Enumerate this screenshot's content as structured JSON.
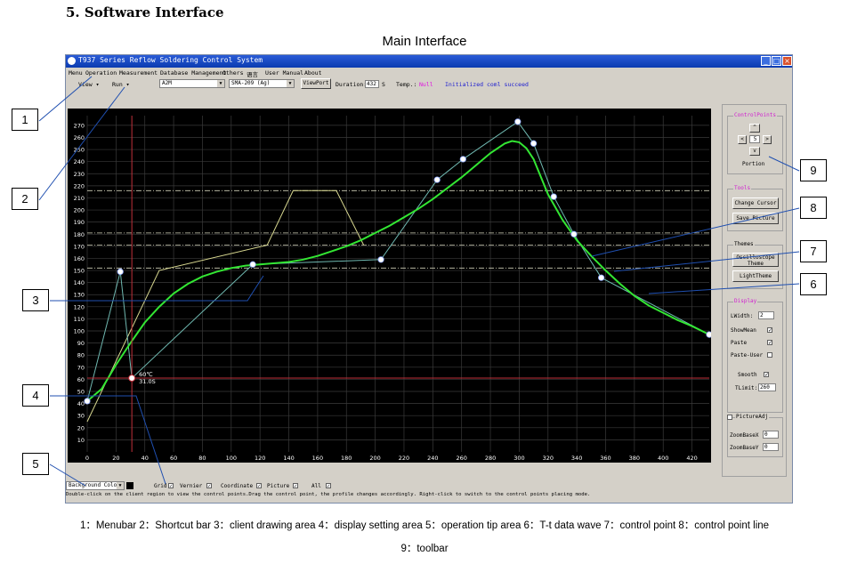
{
  "doc": {
    "section_title": "5. Software Interface",
    "subtitle": "Main Interface",
    "caption_line1": "1：Menubar 2：Shortcut bar 3：client drawing area 4：display setting area 5：operation tip area 6：T-t data wave 7：control point 8：control point line",
    "caption_line2": "9：toolbar"
  },
  "window": {
    "title": "T937 Series Reflow Soldering Control System",
    "minimize": "_",
    "maximize": "□",
    "close": "×"
  },
  "menu": {
    "items": [
      "Menu",
      "Operation",
      "Measurement",
      "Database Management",
      "Others",
      "语言",
      "User Manual",
      "About"
    ]
  },
  "shortcut": {
    "view_label": "View",
    "run_label": "Run",
    "profile_combo": "A2M",
    "solder_combo": "SMA-209 (Ag)",
    "viewport_button": "ViewPort",
    "duration_label": "Duration:",
    "duration_value": "432",
    "duration_unit": "S",
    "temp_label": "Temp.:",
    "temp_value": "Null",
    "status_text": "Initialized coml succeed"
  },
  "right_panel": {
    "control_points_title": "ControlPoints",
    "portion_value": "5",
    "portion_label": "Portion",
    "tools_title": "Tools",
    "change_cursor": "Change Cursor",
    "save_picture": "Save Picture",
    "themes_title": "Themes",
    "oscilloscope_theme": "Oscilloscope Theme",
    "light_theme": "LightTheme",
    "display_title": "Display",
    "lwidth_label": "LWidth:",
    "lwidth_value": "2",
    "show_mean": "ShowMean",
    "paste": "Paste",
    "paste_user": "Paste-User",
    "smooth": "Smooth",
    "tlimit_label": "TLimit:",
    "tlimit_value": "260",
    "picture_adj": "PictureAdj",
    "zoom_x_label": "ZoomBaseX",
    "zoom_x_value": "0",
    "zoom_y_label": "ZoomBaseY",
    "zoom_y_value": "0"
  },
  "bottom_bar": {
    "background_color": "Background Color",
    "grid": "Grid",
    "vernier": "Vernier",
    "coordinate": "Coordinate",
    "picture": "Picture",
    "all": "All"
  },
  "tip": {
    "text": "Double-click on the client region to view the control points.Drag the control point, the profile changes accordingly. Right-click to switch to the control points placing mode."
  },
  "cursor_readout": {
    "temp": "60℃",
    "time": "31.0S"
  },
  "callouts": [
    "1",
    "2",
    "3",
    "4",
    "5",
    "6",
    "7",
    "8",
    "9"
  ],
  "colors": {
    "plot_bg": "#000000",
    "grid": "#3a3a3a",
    "wave": "#33e633",
    "control_line": "#6fb8b0",
    "paste_profile": "#d8d890",
    "cursor": "#c0303a",
    "limit": "#cfcfb8"
  },
  "chart_data": {
    "type": "line",
    "x_ticks": [
      0,
      20,
      40,
      60,
      80,
      100,
      120,
      140,
      160,
      180,
      200,
      220,
      240,
      260,
      280,
      300,
      320,
      340,
      360,
      380,
      400,
      420
    ],
    "y_ticks": [
      10,
      20,
      30,
      40,
      50,
      60,
      70,
      80,
      90,
      100,
      110,
      120,
      130,
      140,
      150,
      160,
      170,
      180,
      190,
      200,
      210,
      220,
      230,
      240,
      250,
      260,
      270
    ],
    "xlim": [
      0,
      432
    ],
    "ylim": [
      0,
      278
    ],
    "grid": true,
    "series": [
      {
        "id": "wave",
        "x": [
          0,
          10,
          20,
          30,
          40,
          50,
          60,
          70,
          80,
          90,
          100,
          110,
          120,
          130,
          140,
          150,
          160,
          170,
          180,
          190,
          200,
          210,
          220,
          230,
          240,
          250,
          260,
          270,
          280,
          290,
          295,
          300,
          305,
          310,
          320,
          330,
          340,
          350,
          360,
          370,
          380,
          390,
          400,
          410,
          420,
          432
        ],
        "y": [
          42,
          52,
          72,
          90,
          107,
          120,
          131,
          139,
          145,
          149,
          152,
          154,
          155,
          156,
          157,
          159,
          162,
          166,
          170,
          175,
          181,
          187,
          194,
          201,
          209,
          218,
          227,
          237,
          247,
          255,
          257,
          256,
          251,
          242,
          213,
          192,
          175,
          162,
          150,
          139,
          129,
          121,
          115,
          109,
          104,
          97
        ]
      },
      {
        "id": "control_points",
        "x": [
          0,
          23,
          31,
          115,
          204,
          243,
          261,
          299,
          310,
          324,
          338,
          357,
          432
        ],
        "y": [
          42,
          149,
          61,
          155,
          159,
          225,
          242,
          273,
          255,
          211,
          180,
          144,
          97
        ]
      },
      {
        "id": "paste_profile",
        "x": [
          0,
          50,
          125,
          143,
          173,
          192
        ],
        "y": [
          25,
          150,
          171,
          216,
          216,
          171
        ]
      }
    ],
    "limit_lines_y": [
      216,
      181,
      171,
      152
    ],
    "cursor": {
      "x": 31,
      "y": 61
    }
  }
}
